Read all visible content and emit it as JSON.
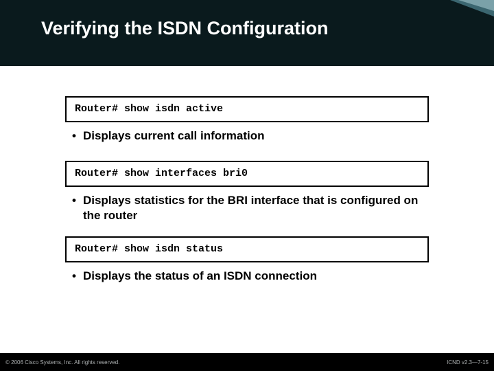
{
  "slide": {
    "title": "Verifying the ISDN Configuration",
    "blocks": [
      {
        "command": "Router# show isdn active",
        "bullet": "Displays current call information"
      },
      {
        "command": "Router# show interfaces bri0",
        "bullet": "Displays statistics for the BRI interface that is configured on the router"
      },
      {
        "command": "Router# show isdn status",
        "bullet": "Displays the status of an ISDN connection"
      }
    ],
    "footer": {
      "copyright": "© 2006 Cisco Systems, Inc. All rights reserved.",
      "code": "ICND v2.3—7-15"
    }
  }
}
